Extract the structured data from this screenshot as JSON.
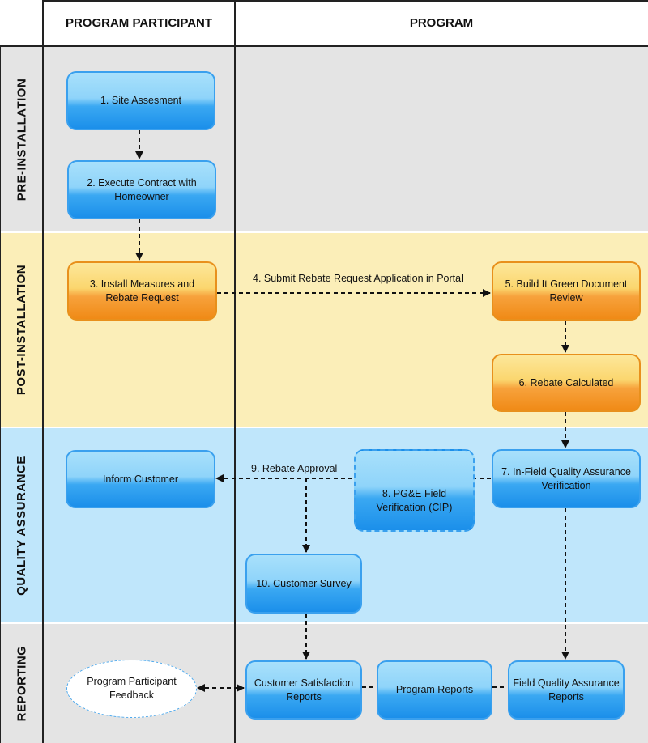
{
  "columns": {
    "participant": "PROGRAM PARTICIPANT",
    "program": "PROGRAM"
  },
  "lanes": {
    "pre": "PRE-INSTALLATION",
    "post": "POST-INSTALLATION",
    "qa": "QUALITY ASSURANCE",
    "reporting": "REPORTING"
  },
  "colors": {
    "pre": "#e4e4e4",
    "post": "#fbeeb8",
    "qa": "#bfe6fb",
    "reporting": "#e4e4e4",
    "box_blue": "#3aa8f2",
    "box_orange": "#f7a23c"
  },
  "steps": {
    "s1": "1. Site Assesment",
    "s2": "2. Execute Contract with Homeowner",
    "s3": "3. Install Measures and Rebate Request",
    "s5": "5. Build It Green Document Review",
    "s6": "6. Rebate Calculated",
    "s7": "7. In-Field Quality Assurance Verification",
    "s8": "8. PG&E Field Verification (CIP)",
    "s10": "10. Customer Survey",
    "inform": "Inform Customer",
    "feedback": "Program Participant Feedback",
    "csr": "Customer Satisfaction Reports",
    "pr": "Program Reports",
    "fqar": "Field Quality Assurance Reports"
  },
  "edges": {
    "e4": "4. Submit Rebate Request Application in Portal",
    "e9": "9. Rebate Approval"
  }
}
